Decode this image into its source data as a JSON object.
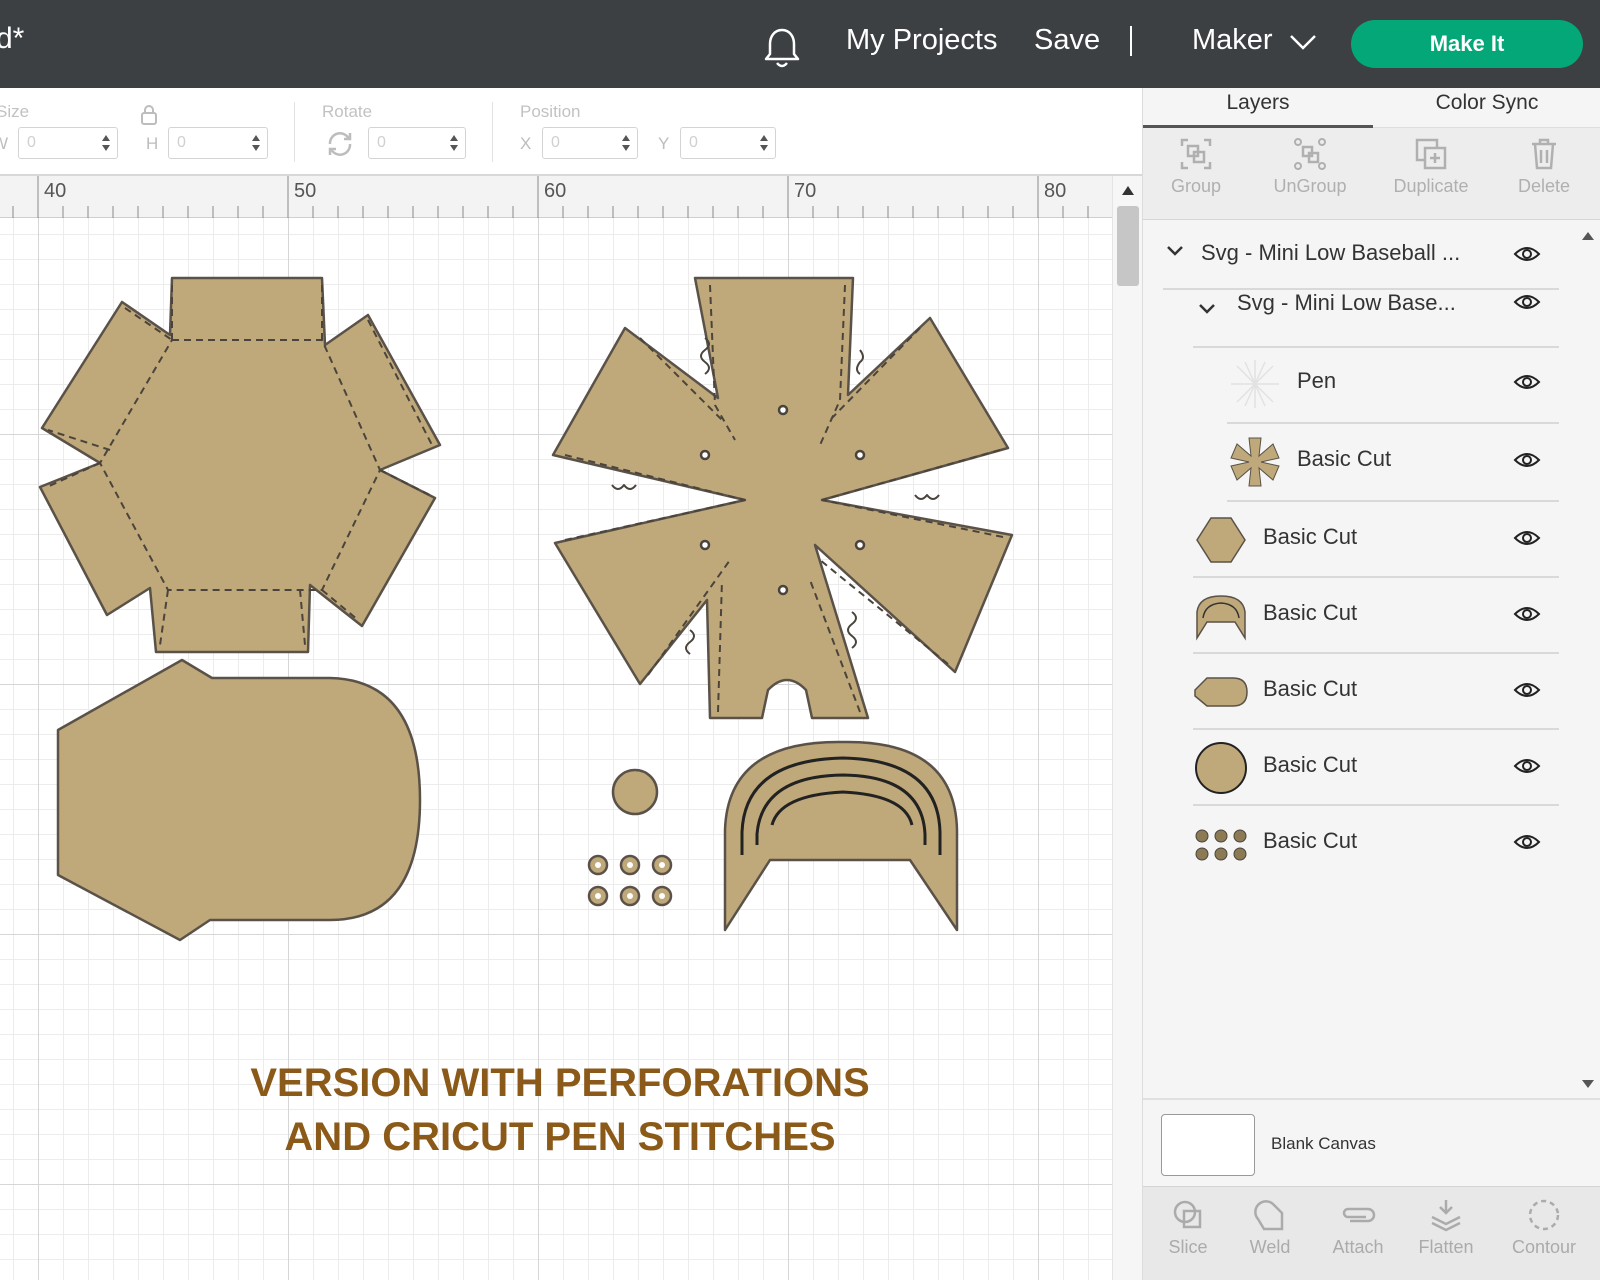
{
  "topbar": {
    "title": "d*",
    "my_projects": "My Projects",
    "save": "Save",
    "separator": "|",
    "machine": "Maker",
    "make_it": "Make It",
    "make_it_color": "#04a777"
  },
  "edit_toolbar": {
    "size_label": "Size",
    "w_label": "W",
    "w_value": "0",
    "h_label": "H",
    "h_value": "0",
    "rotate_label": "Rotate",
    "rotate_value": "0",
    "position_label": "Position",
    "x_label": "X",
    "x_value": "0",
    "y_label": "Y",
    "y_value": "0"
  },
  "ruler": {
    "ticks": [
      "40",
      "50",
      "60",
      "70",
      "80"
    ]
  },
  "canvas": {
    "caption_line1": "VERSION WITH PERFORATIONS",
    "caption_line2": "AND CRICUT PEN STITCHES",
    "shape_fill": "#bfa97a",
    "shape_stroke": "#5a5248",
    "caption_color": "#8b5a18"
  },
  "panel": {
    "tabs": [
      "Layers",
      "Color Sync"
    ],
    "actions": [
      "Group",
      "UnGroup",
      "Duplicate",
      "Delete"
    ],
    "layers": [
      {
        "label": "Svg - Mini Low Baseball ...",
        "level": 0,
        "icon": "caret-down"
      },
      {
        "label": "Svg - Mini Low Base...",
        "level": 1,
        "icon": "caret-down"
      },
      {
        "label": "Pen",
        "level": 2,
        "icon": "pen-burst-thumb"
      },
      {
        "label": "Basic Cut",
        "level": 2,
        "icon": "flower-thumb"
      },
      {
        "label": "Basic Cut",
        "level": 1,
        "icon": "hexagon-thumb"
      },
      {
        "label": "Basic Cut",
        "level": 1,
        "icon": "visor-thumb"
      },
      {
        "label": "Basic Cut",
        "level": 1,
        "icon": "crown-thumb"
      },
      {
        "label": "Basic Cut",
        "level": 1,
        "icon": "circle-thumb"
      },
      {
        "label": "Basic Cut",
        "level": 1,
        "icon": "eyelets-thumb"
      }
    ],
    "blank_canvas": "Blank Canvas",
    "bottom_actions": [
      "Slice",
      "Weld",
      "Attach",
      "Flatten",
      "Contour"
    ]
  }
}
